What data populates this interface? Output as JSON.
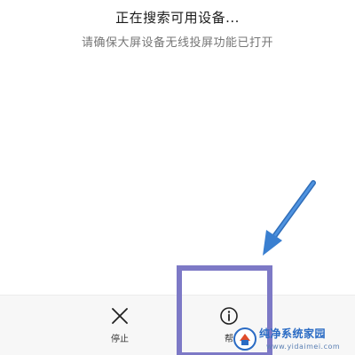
{
  "status": {
    "title": "正在搜索可用设备...",
    "subtitle": "请确保大屏设备无线投屏功能已打开"
  },
  "actions": {
    "stop_label": "停止",
    "help_label": "帮"
  },
  "watermark": {
    "brand": "纯净系统家园",
    "url": "www.yidaimei.com"
  },
  "annotation": {
    "box_color": "#7d79c6",
    "arrow_color": "#3a7fd0"
  }
}
